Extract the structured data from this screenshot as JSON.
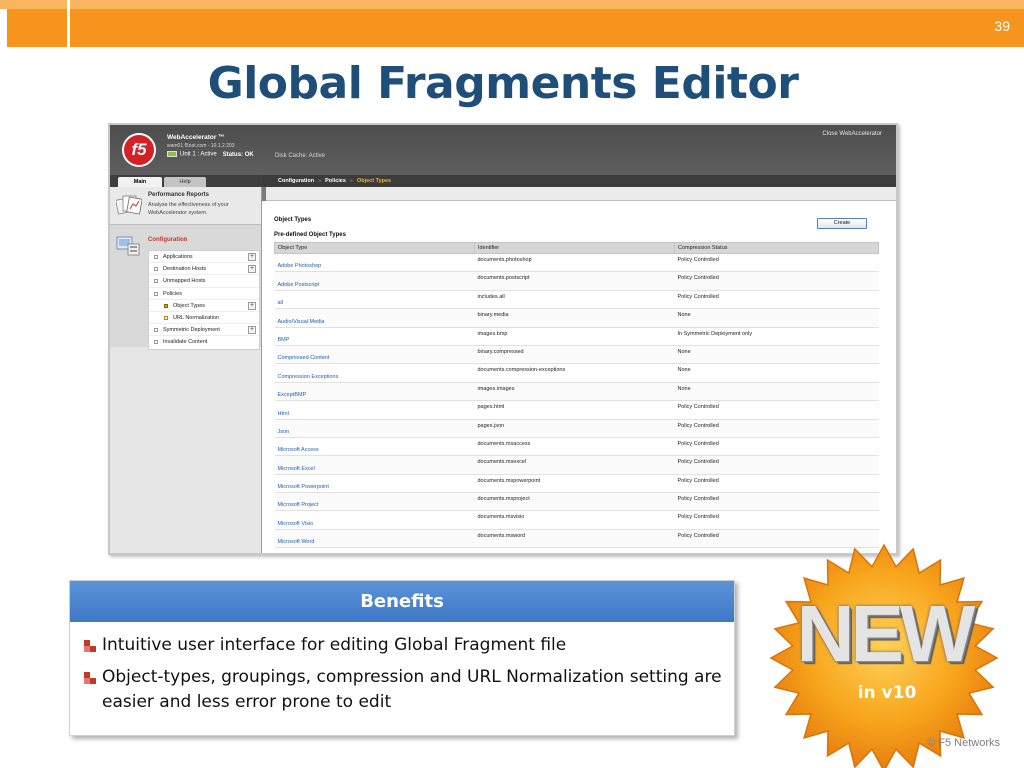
{
  "slide": {
    "number": "39",
    "title": "Global Fragments Editor",
    "copyright": "© F5 Networks",
    "colors": {
      "accent_orange": "#f7941d",
      "title_blue": "#1f4e79",
      "benefits_blue": "#4a86d4"
    }
  },
  "app": {
    "logo_text": "f5",
    "product_name": "WebAccelerator ™",
    "host": "wam01.f5net.com - 10.1.2.203",
    "unit": "Unit 1 : Active",
    "status_label": "Status: OK",
    "disk_cache": "Disk Cache: Active",
    "close_link": "Close WebAccelerator",
    "tabs": [
      {
        "label": "Main",
        "active": true
      },
      {
        "label": "Help",
        "active": false
      }
    ],
    "breadcrumb": [
      "Configuration",
      "Policies",
      "Object Types"
    ]
  },
  "sidebar": {
    "performance": {
      "title": "Performance Reports",
      "description": "Analyse the effectiveness of your WebAccelerator system."
    },
    "configuration": {
      "title": "Configuration",
      "items": [
        {
          "label": "Applications",
          "expandable": true,
          "level": 0
        },
        {
          "label": "Destination Hosts",
          "expandable": true,
          "level": 0
        },
        {
          "label": "Unmapped Hosts",
          "expandable": false,
          "level": 0
        },
        {
          "label": "Policies",
          "expandable": false,
          "level": 0
        },
        {
          "label": "Object Types",
          "expandable": true,
          "level": 1,
          "selected": true
        },
        {
          "label": "URL Normalization",
          "expandable": false,
          "level": 1
        },
        {
          "label": "Symmetric Deployment",
          "expandable": true,
          "level": 0
        },
        {
          "label": "Invalidate Content",
          "expandable": false,
          "level": 0
        }
      ]
    }
  },
  "content": {
    "section_title": "Object Types",
    "create_button": "Create",
    "table_title": "Pre-defined Object Types",
    "columns": [
      "Object Type",
      "Identifier",
      "Compression Status"
    ],
    "rows": [
      [
        "Adobe Photoshop",
        "documents.photoshop",
        "Policy Controlled"
      ],
      [
        "Adobe Postscript",
        "documents.postscript",
        "Policy Controlled"
      ],
      [
        "all",
        "includes.all",
        "Policy Controlled"
      ],
      [
        "Audio/Visual Media",
        "binary.media",
        "None"
      ],
      [
        "BMP",
        "images.bmp",
        "In Symmetric Deployment only"
      ],
      [
        "Compressed Content",
        "binary.compressed",
        "None"
      ],
      [
        "Compression Exceptions",
        "documents.compression-exceptions",
        "None"
      ],
      [
        "ExceptBMP",
        "images.images",
        "None"
      ],
      [
        "Html",
        "pages.html",
        "Policy Controlled"
      ],
      [
        "Json",
        "pages.json",
        "Policy Controlled"
      ],
      [
        "Microsoft Access",
        "documents.msaccess",
        "Policy Controlled"
      ],
      [
        "Microsoft Excel",
        "documents.msexcel",
        "Policy Controlled"
      ],
      [
        "Microsoft Powerpoint",
        "documents.mspowerpoint",
        "Policy Controlled"
      ],
      [
        "Microsoft Project",
        "documents.msproject",
        "Policy Controlled"
      ],
      [
        "Microsoft Visio",
        "documents.msvisio",
        "Policy Controlled"
      ],
      [
        "Microsoft Word",
        "documents.msword",
        "Policy Controlled"
      ]
    ]
  },
  "benefits": {
    "header": "Benefits",
    "items": [
      "Intuitive user interface for editing Global Fragment file",
      "Object-types, groupings, compression and URL Normalization setting are easier and less error prone to edit"
    ]
  },
  "badge": {
    "text": "NEW",
    "subtext": "in v10",
    "color": "#f7a21b"
  }
}
